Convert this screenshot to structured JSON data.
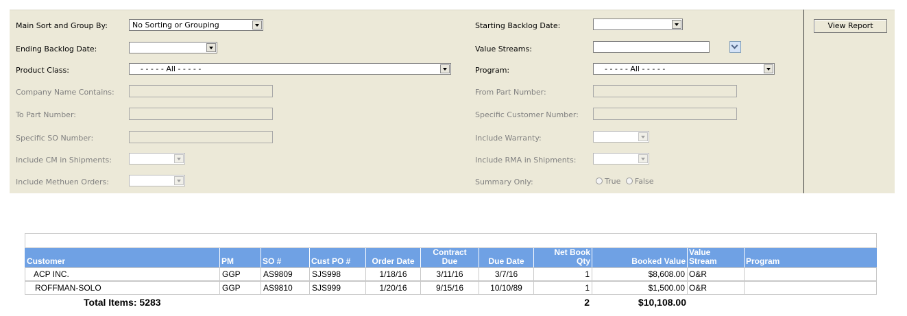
{
  "filters": {
    "main_sort_label": "Main Sort and Group By:",
    "main_sort_value": "No Sorting or Grouping",
    "ending_backlog_label": "Ending Backlog Date:",
    "ending_backlog_value": "",
    "product_class_label": "Product Class:",
    "product_class_value": "- - - - - All - - - - -",
    "company_name_label": "Company Name Contains:",
    "to_part_label": "To Part Number:",
    "specific_so_label": "Specific SO Number:",
    "include_cm_label": "Include CM in Shipments:",
    "include_methuen_label": "Include Methuen Orders:",
    "starting_backlog_label": "Starting Backlog Date:",
    "starting_backlog_value": "",
    "value_streams_label": "Value Streams:",
    "value_streams_value": "",
    "program_label": "Program:",
    "program_value": "- - - - - All - - - - -",
    "from_part_label": "From Part Number:",
    "specific_customer_label": "Specific Customer Number:",
    "include_warranty_label": "Include Warranty:",
    "include_rma_label": "Include RMA in Shipments:",
    "summary_only_label": "Summary Only:",
    "summary_true": "True",
    "summary_false": "False"
  },
  "view_report_label": "View Report",
  "table": {
    "headers": {
      "customer": "Customer",
      "pm": "PM",
      "so": "SO #",
      "cust_po": "Cust PO #",
      "order_date": "Order Date",
      "contract_due_1": "Contract",
      "contract_due_2": "Due",
      "due_date": "Due Date",
      "net_book_1": "Net Book",
      "net_book_2": "Qty",
      "booked_value": "Booked Value",
      "value_stream_1": "Value",
      "value_stream_2": "Stream",
      "program": "Program"
    },
    "rows": [
      {
        "customer": "ACP INC.",
        "pm": "GGP",
        "so": "AS9809",
        "cust_po": "SJS998",
        "order_date": "1/18/16",
        "contract_due": "3/11/16",
        "due_date": "3/7/16",
        "net_book_qty": "1",
        "booked_value": "$8,608.00",
        "value_stream": "O&R",
        "program": ""
      },
      {
        "customer": "ROFFMAN-SOLO",
        "pm": "GGP",
        "so": "AS9810",
        "cust_po": "SJS999",
        "order_date": "1/20/16",
        "contract_due": "9/15/16",
        "due_date": "10/10/89",
        "net_book_qty": "1",
        "booked_value": "$1,500.00",
        "value_stream": "O&R",
        "program": ""
      }
    ],
    "total_items_label": "Total Items: 5283",
    "total_qty": "2",
    "total_value": "$10,108.00"
  }
}
